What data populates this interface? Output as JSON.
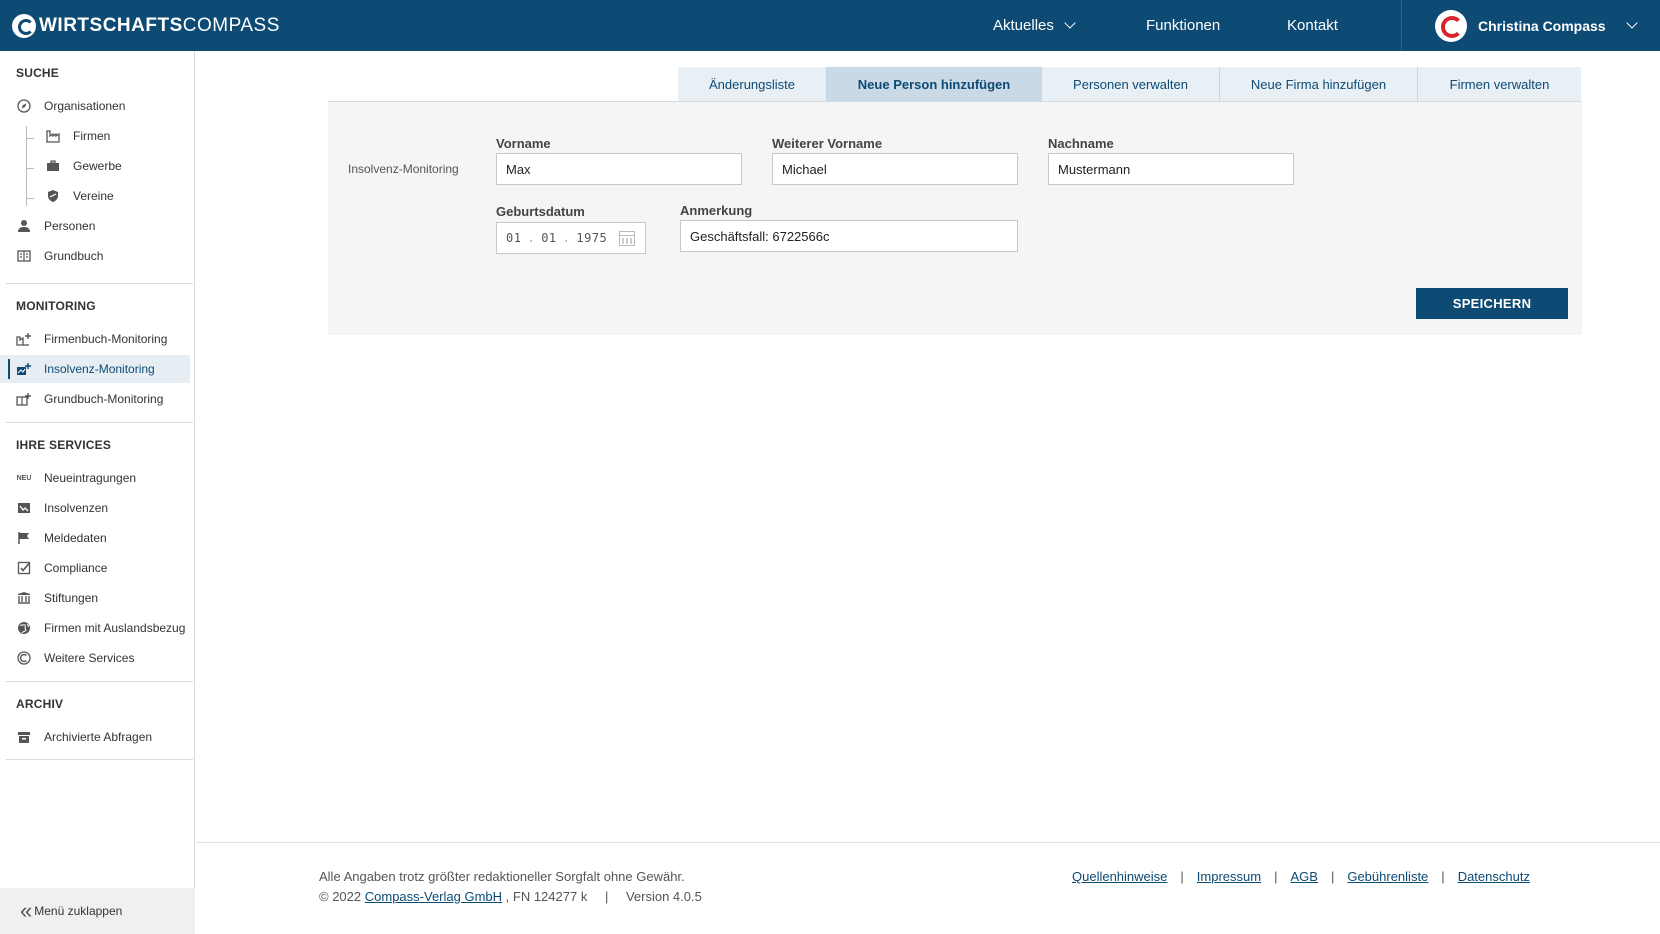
{
  "header": {
    "brand_bold": "WIRTSCHAFTS",
    "brand_light": "COMPASS",
    "nav": {
      "aktuelles": "Aktuelles",
      "funktionen": "Funktionen",
      "kontakt": "Kontakt"
    },
    "user_name": "Christina Compass"
  },
  "sidebar": {
    "suche_title": "SUCHE",
    "suche_items": {
      "organisationen": "Organisationen",
      "firmen": "Firmen",
      "gewerbe": "Gewerbe",
      "vereine": "Vereine",
      "personen": "Personen",
      "grundbuch": "Grundbuch"
    },
    "monitoring_title": "MONITORING",
    "monitoring_items": {
      "firmenbuch": "Firmenbuch-Monitoring",
      "insolvenz": "Insolvenz-Monitoring",
      "grundbuch": "Grundbuch-Monitoring"
    },
    "services_title": "IHRE SERVICES",
    "services_items": {
      "neueintragungen_badge": "NEU",
      "neueintragungen": "Neueintragungen",
      "insolvenzen": "Insolvenzen",
      "meldedaten": "Meldedaten",
      "compliance": "Compliance",
      "stiftungen": "Stiftungen",
      "auslandsbezug": "Firmen mit Auslandsbezug",
      "weitere": "Weitere Services"
    },
    "archiv_title": "ARCHIV",
    "archiv_items": {
      "archivierte": "Archivierte Abfragen"
    },
    "collapse_label": "Menü zuklappen"
  },
  "tabs": {
    "aenderungsliste": "Änderungsliste",
    "neue_person": "Neue Person hinzufügen",
    "personen_verwalten": "Personen verwalten",
    "neue_firma": "Neue Firma hinzufügen",
    "firmen_verwalten": "Firmen verwalten"
  },
  "form": {
    "section_label": "Insolvenz-Monitoring",
    "vorname_label": "Vorname",
    "vorname_value": "Max",
    "weiterer_vorname_label": "Weiterer Vorname",
    "weiterer_vorname_value": "Michael",
    "nachname_label": "Nachname",
    "nachname_value": "Mustermann",
    "geburtsdatum_label": "Geburtsdatum",
    "geburtsdatum_day": "01",
    "geburtsdatum_month": "01",
    "geburtsdatum_year": "1975",
    "anmerkung_label": "Anmerkung",
    "anmerkung_value": "Geschäftsfall: 6722566c",
    "save_label": "SPEICHERN"
  },
  "footer": {
    "disclaimer": "Alle Angaben trotz größter redaktioneller Sorgfalt ohne Gewähr.",
    "copyright_prefix": "© 2022",
    "publisher_link": "Compass-Verlag GmbH",
    "copyright_suffix": ", FN 124277 k",
    "version": "Version 4.0.5",
    "links": {
      "quellen": "Quellenhinweise",
      "impressum": "Impressum",
      "agb": "AGB",
      "gebuehren": "Gebührenliste",
      "datenschutz": "Datenschutz"
    }
  },
  "colors": {
    "brand": "#0d4a74",
    "accent_red": "#d8232a",
    "panel_bg": "#f5f5f5"
  }
}
